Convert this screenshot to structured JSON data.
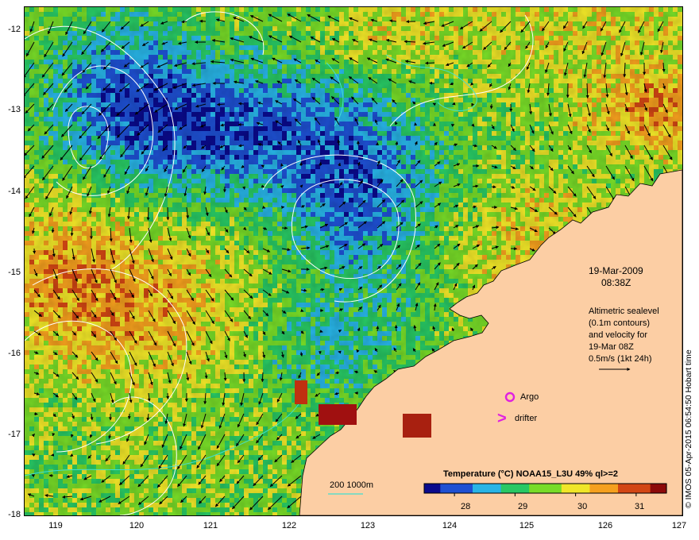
{
  "map": {
    "date": "19-Mar-2009",
    "time": "08:38Z",
    "altimetry_note": [
      "Altimetric sealevel",
      "(0.1m contours)",
      "and velocity for",
      "19-Mar 08Z",
      "0.5m/s (1kt 24h)"
    ],
    "legend_argo": "Argo",
    "legend_drifter": "drifter",
    "drifter_symbol": ">",
    "bathymetry_label": "200  1000m",
    "colorbar_title": "Temperature (°C) NOAA15_L3U 49% ql>=2",
    "colorbar_ticks": [
      "28",
      "29",
      "30",
      "31"
    ],
    "credit": "© IMOS 05-Apr-2015 06:54:50 Hobart time",
    "lat_ticks": [
      "-12",
      "-13",
      "-14",
      "-15",
      "-16",
      "-17",
      "-18"
    ],
    "lon_ticks": [
      "119",
      "120",
      "121",
      "122",
      "123",
      "124",
      "125",
      "126",
      "127"
    ],
    "colors": {
      "land": "#fccea4",
      "argo": "#e020e0",
      "drifter": "#e020e0",
      "contour": "#ffffff",
      "bathymetry": "#40e0d0",
      "colormap": [
        "#0a0a8c",
        "#1e50d2",
        "#28b4e6",
        "#28c864",
        "#78dc28",
        "#f0e628",
        "#f5a01e",
        "#d24614",
        "#8c0a0a"
      ]
    },
    "temperature_range": [
      27.5,
      31.5
    ]
  }
}
